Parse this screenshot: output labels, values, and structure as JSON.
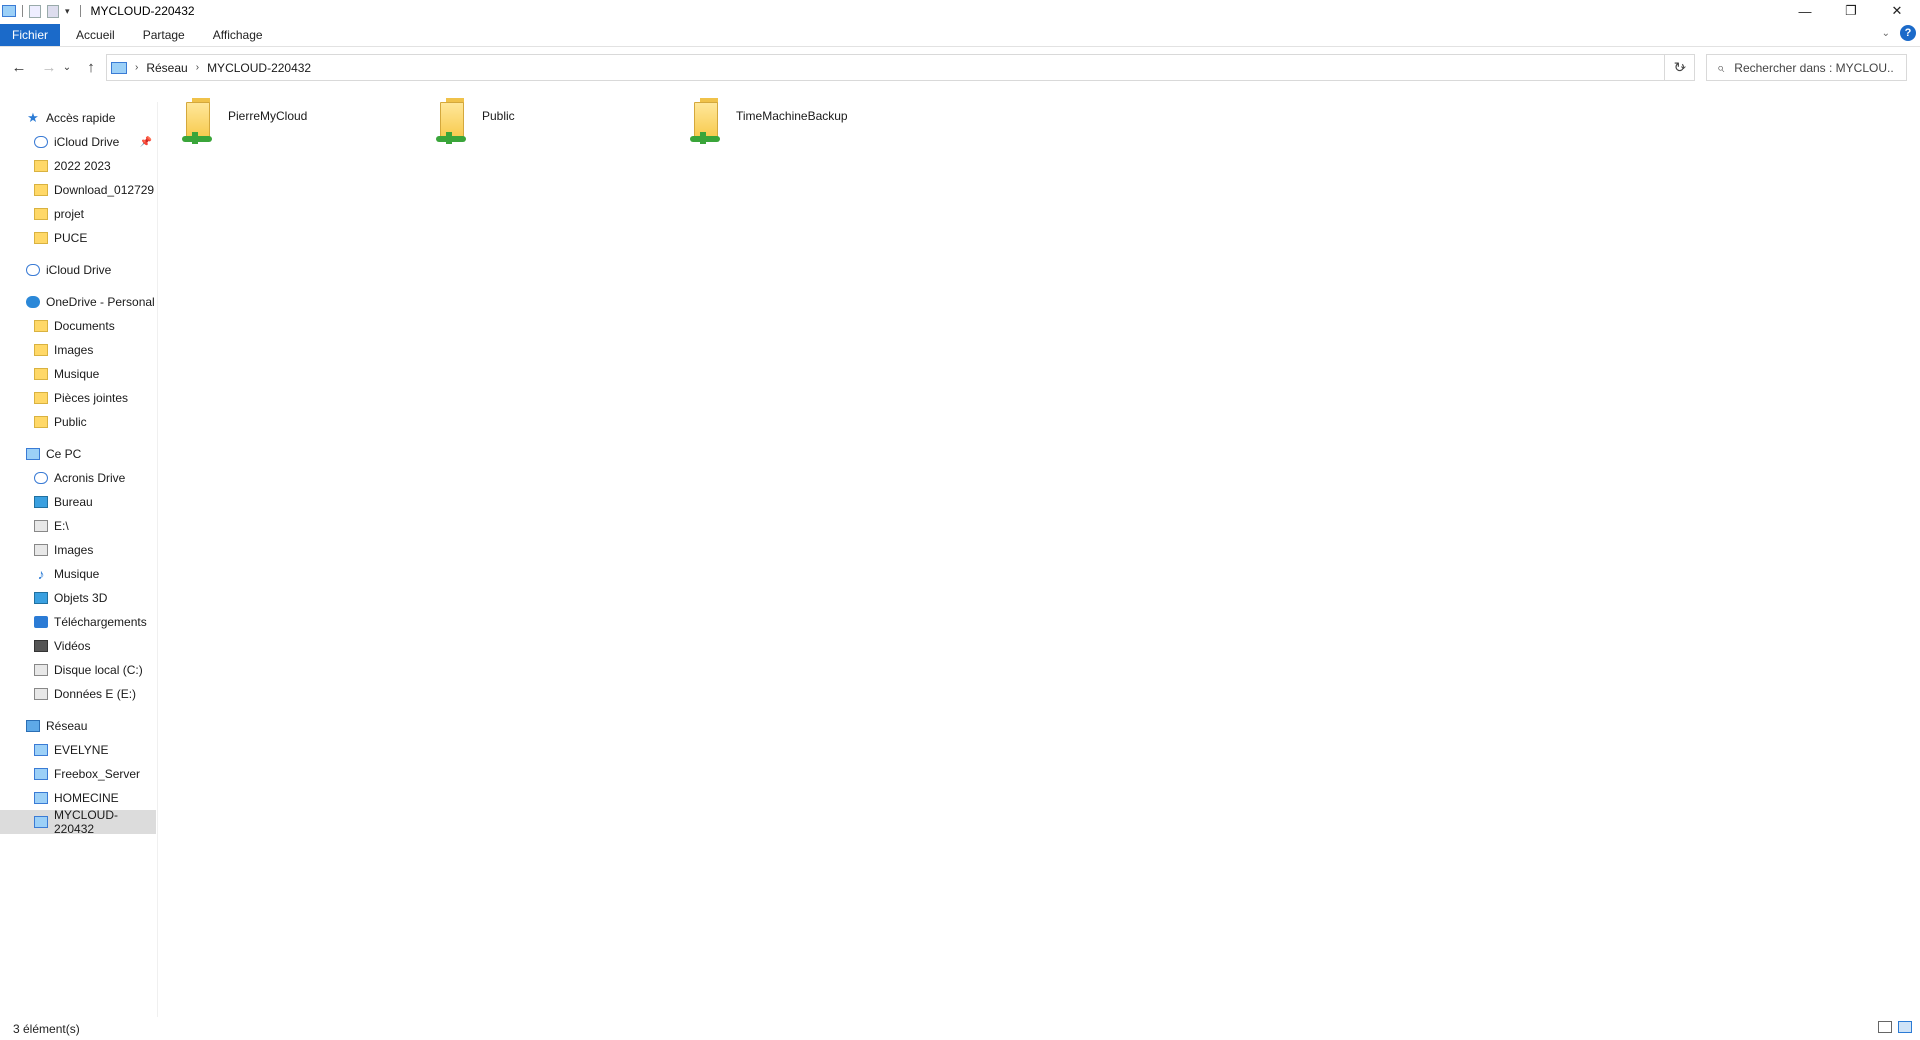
{
  "window": {
    "title": "MYCLOUD-220432",
    "controls": {
      "minimize": "—",
      "restore": "❐",
      "close": "✕"
    }
  },
  "ribbon": {
    "tabs": [
      "Fichier",
      "Accueil",
      "Partage",
      "Affichage"
    ],
    "help": "?"
  },
  "address": {
    "crumbs": [
      "Réseau",
      "MYCLOUD-220432"
    ]
  },
  "search": {
    "placeholder": "Rechercher dans : MYCLOU..."
  },
  "sidebar": {
    "quick_access": {
      "label": "Accès rapide",
      "items": [
        "iCloud Drive",
        "2022 2023",
        "Download_012729",
        "projet",
        "PUCE"
      ]
    },
    "icloud": {
      "label": "iCloud Drive"
    },
    "onedrive": {
      "label": "OneDrive - Personal",
      "items": [
        "Documents",
        "Images",
        "Musique",
        "Pièces jointes",
        "Public"
      ]
    },
    "this_pc": {
      "label": "Ce PC",
      "items": [
        "Acronis Drive",
        "Bureau",
        "E:\\",
        "Images",
        "Musique",
        "Objets 3D",
        "Téléchargements",
        "Vidéos",
        "Disque local (C:)",
        "Données E (E:)"
      ]
    },
    "network": {
      "label": "Réseau",
      "items": [
        "EVELYNE",
        "Freebox_Server",
        "HOMECINE",
        "MYCLOUD-220432"
      ]
    }
  },
  "content": {
    "items": [
      "PierreMyCloud",
      "Public",
      "TimeMachineBackup"
    ]
  },
  "status": {
    "count": "3 élément(s)"
  }
}
